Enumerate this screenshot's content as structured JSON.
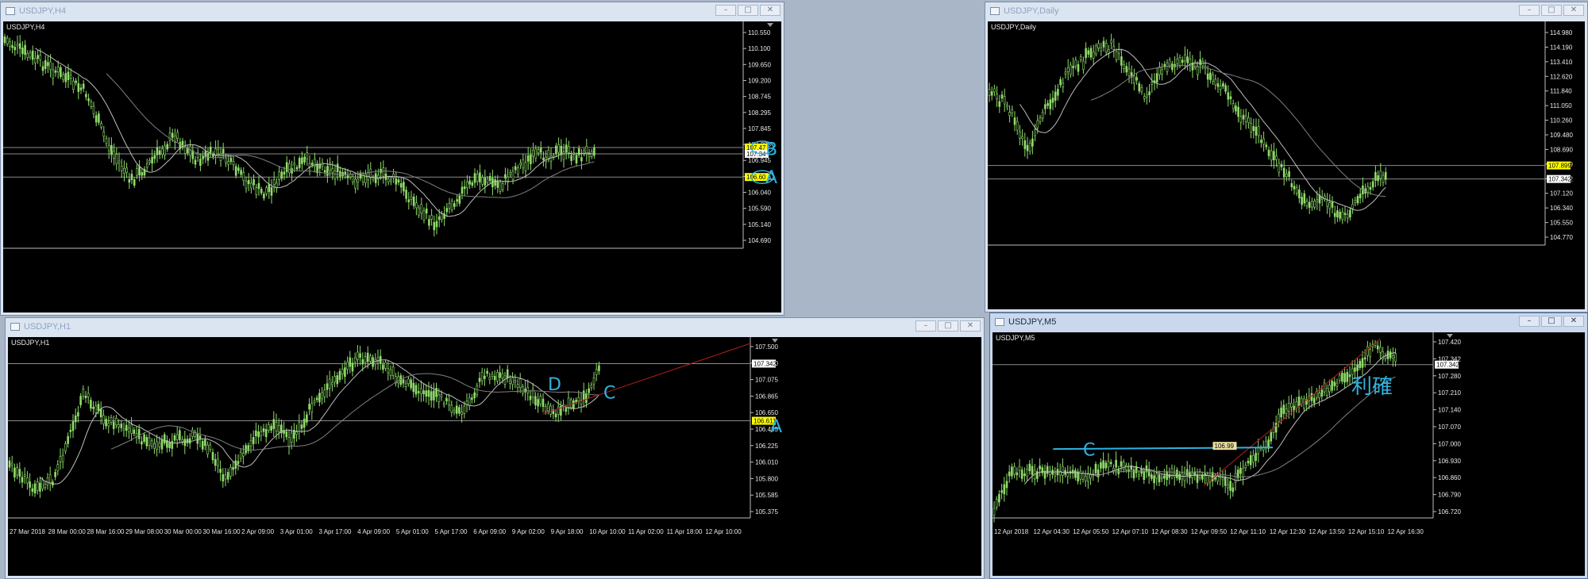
{
  "windows": [
    {
      "id": "h4",
      "title": "USDJPY,H4",
      "chart_label": "USDJPY,H4",
      "active": false,
      "price_axis": [
        "110.550",
        "110.100",
        "109.650",
        "109.200",
        "108.745",
        "108.295",
        "107.845",
        "107.395",
        "106.945",
        "106.495",
        "106.040",
        "105.590",
        "105.140",
        "104.690"
      ],
      "markers": [
        {
          "text": "107.47",
          "color": "#ffff00"
        },
        {
          "text": "107.34",
          "color": "#ffffff"
        },
        {
          "text": "106.60",
          "color": "#ffff00"
        }
      ],
      "time_axis": [],
      "annotations": [
        {
          "text": "B"
        },
        {
          "text": "A"
        }
      ]
    },
    {
      "id": "daily",
      "title": "USDJPY,Daily",
      "chart_label": "USDJPY,Daily",
      "active": false,
      "price_axis": [
        "114.980",
        "114.190",
        "113.410",
        "112.620",
        "111.840",
        "111.050",
        "110.260",
        "109.480",
        "108.690",
        "107.899",
        "107.342",
        "107.120",
        "106.340",
        "105.550",
        "104.770"
      ],
      "markers": [
        {
          "text": "107.899",
          "color": "#ffff00"
        },
        {
          "text": "107.342",
          "color": "#ffffff"
        }
      ],
      "time_axis": [],
      "annotations": []
    },
    {
      "id": "h1",
      "title": "USDJPY,H1",
      "chart_label": "USDJPY,H1",
      "active": false,
      "price_axis": [
        "107.500",
        "107.290",
        "107.075",
        "106.865",
        "106.650",
        "106.435",
        "106.225",
        "106.010",
        "105.800",
        "105.585",
        "105.375"
      ],
      "markers": [
        {
          "text": "107.342",
          "color": "#ffffff"
        },
        {
          "text": "106.611",
          "color": "#ffff00"
        }
      ],
      "time_axis": [
        "27 Mar 2018",
        "28 Mar 00:00",
        "28 Mar 16:00",
        "29 Mar 08:00",
        "30 Mar 00:00",
        "30 Mar 16:00",
        "2 Apr 09:00",
        "3 Apr 01:00",
        "3 Apr 17:00",
        "4 Apr 09:00",
        "5 Apr 01:00",
        "5 Apr 17:00",
        "6 Apr 09:00",
        "9 Apr 02:00",
        "9 Apr 18:00",
        "10 Apr 10:00",
        "11 Apr 02:00",
        "11 Apr 18:00",
        "12 Apr 10:00"
      ],
      "annotations": [
        {
          "text": "D"
        },
        {
          "text": "C"
        },
        {
          "text": "A"
        }
      ]
    },
    {
      "id": "m5",
      "title": "USDJPY,M5",
      "chart_label": "USDJPY,M5",
      "active": true,
      "price_axis": [
        "107.420",
        "107.342",
        "107.280",
        "107.210",
        "107.140",
        "107.070",
        "107.000",
        "106.930",
        "106.860",
        "106.790",
        "106.720"
      ],
      "markers": [
        {
          "text": "107.342",
          "color": "#ffffff"
        },
        {
          "text": "106.99",
          "color": "#e9dfa0"
        }
      ],
      "time_axis": [
        "12 Apr 2018",
        "12 Apr 04:30",
        "12 Apr 05:50",
        "12 Apr 07:10",
        "12 Apr 08:30",
        "12 Apr 09:50",
        "12 Apr 11:10",
        "12 Apr 12:30",
        "12 Apr 13:50",
        "12 Apr 15:10",
        "12 Apr 16:30"
      ],
      "annotations": [
        {
          "text": "C"
        },
        {
          "text": "利確"
        }
      ]
    }
  ],
  "colors": {
    "candle": "#8fdc6a",
    "ma": "#bdbdbd",
    "grid_line": "#8a8a8a",
    "annotation": "#2fb3e0",
    "trend": "#b01e1e"
  }
}
